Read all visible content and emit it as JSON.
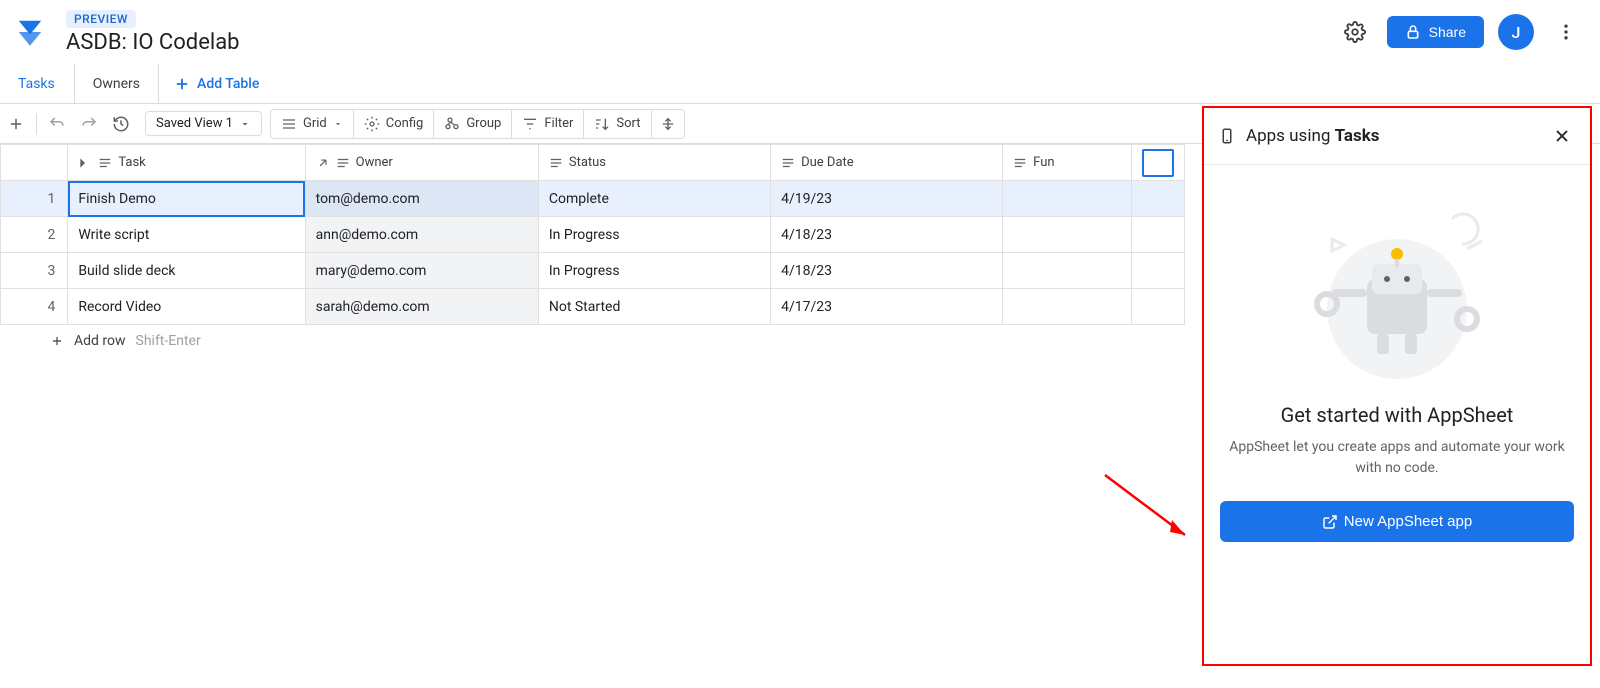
{
  "header": {
    "badge": "PREVIEW",
    "title": "ASDB: IO Codelab",
    "share_label": "Share",
    "avatar_initial": "J"
  },
  "tabs": {
    "tasks": "Tasks",
    "owners": "Owners",
    "add_table": "Add Table"
  },
  "toolbar": {
    "saved_view": "Saved View 1",
    "grid": "Grid",
    "config": "Config",
    "group": "Group",
    "filter": "Filter",
    "sort": "Sort"
  },
  "columns": {
    "task": "Task",
    "owner": "Owner",
    "status": "Status",
    "due_date": "Due Date",
    "fun": "Fun"
  },
  "rows": [
    {
      "num": "1",
      "task": "Finish Demo",
      "owner": "tom@demo.com",
      "status": "Complete",
      "due": "4/19/23",
      "fun": ""
    },
    {
      "num": "2",
      "task": "Write script",
      "owner": "ann@demo.com",
      "status": "In Progress",
      "due": "4/18/23",
      "fun": ""
    },
    {
      "num": "3",
      "task": "Build slide deck",
      "owner": "mary@demo.com",
      "status": "In Progress",
      "due": "4/18/23",
      "fun": ""
    },
    {
      "num": "4",
      "task": "Record Video",
      "owner": "sarah@demo.com",
      "status": "Not Started",
      "due": "4/17/23",
      "fun": ""
    }
  ],
  "add_row": {
    "label": "Add row",
    "hint": "Shift-Enter"
  },
  "panel": {
    "title_prefix": "Apps using ",
    "title_bold": "Tasks",
    "heading": "Get started with AppSheet",
    "desc": "AppSheet let you create apps and automate your work with no code.",
    "button": "New AppSheet app"
  }
}
